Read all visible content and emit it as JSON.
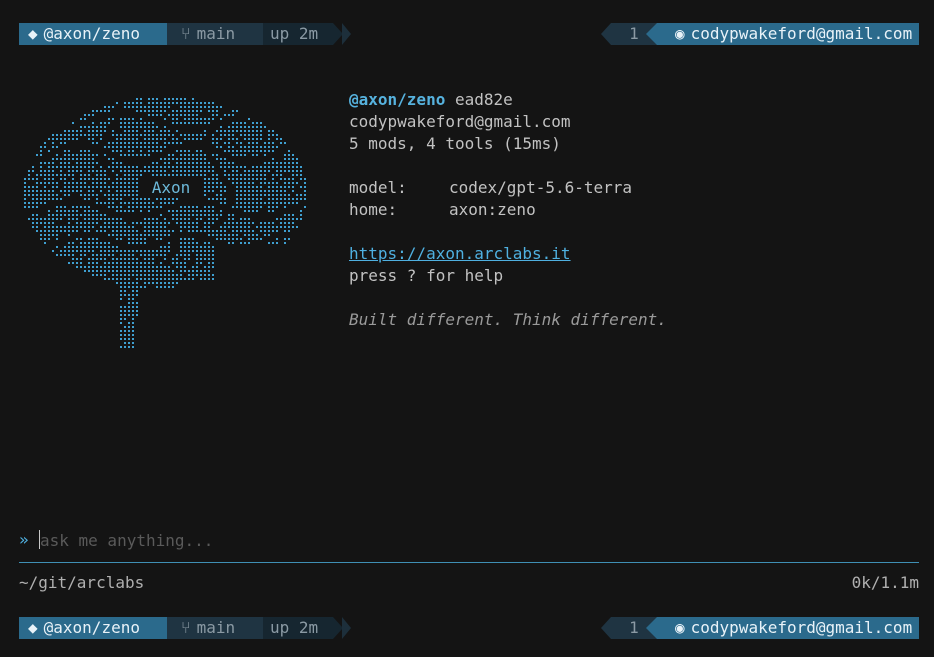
{
  "statusline": {
    "repo_icon": "◆",
    "repo": "@axon/zeno",
    "branch_icon": "⑂",
    "branch": "main",
    "uptime": "up 2m",
    "count": "1",
    "user_icon": "◉",
    "user": "codypwakeford@gmail.com"
  },
  "logo": {
    "label": "Axon",
    "icon": "brain-ascii-art",
    "color": "#3f9fd0"
  },
  "info": {
    "handle": "@axon/zeno",
    "commit": "ead82e",
    "email": "codypwakeford@gmail.com",
    "stats": "5 mods, 4 tools (15ms)",
    "model_label": "model:",
    "model_value": "codex/gpt-5.6-terra",
    "home_label": "home:",
    "home_value": "axon:zeno",
    "url": "https://axon.arclabs.it",
    "help": "press ? for help",
    "tagline": "Built different. Think different."
  },
  "prompt": {
    "marker": "»",
    "placeholder": "ask me anything..."
  },
  "footer": {
    "cwd": "~/git/arclabs",
    "tokens": "0k/1.1m"
  },
  "colors": {
    "accent": "#2b6a8c",
    "link": "#4fb0e0",
    "background": "#141414"
  }
}
